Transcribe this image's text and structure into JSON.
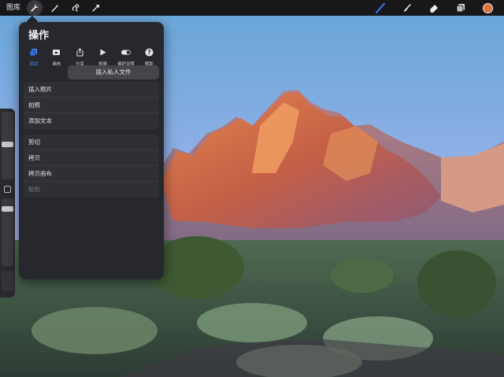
{
  "toolbar": {
    "gallery_label": "图库",
    "left_tools": [
      {
        "icon": "wrench-icon"
      },
      {
        "icon": "magic-wand-icon"
      },
      {
        "icon": "selection-icon"
      },
      {
        "icon": "transform-arrow-icon"
      }
    ],
    "right_tools": [
      {
        "icon": "brush-icon",
        "color": "#3d7dff"
      },
      {
        "icon": "smudge-icon",
        "color": "#ededed"
      },
      {
        "icon": "eraser-icon",
        "color": "#ededed"
      },
      {
        "icon": "layers-icon",
        "color": "#ededed"
      }
    ],
    "current_color": "#e0713b"
  },
  "actions_panel": {
    "title": "操作",
    "tabs": [
      {
        "label": "添加",
        "icon": "add-file-icon",
        "active": true
      },
      {
        "label": "画布",
        "icon": "canvas-icon",
        "active": false
      },
      {
        "label": "分享",
        "icon": "share-icon",
        "active": false
      },
      {
        "label": "视频",
        "icon": "video-play-icon",
        "active": false
      },
      {
        "label": "偏好设置",
        "icon": "toggle-icon",
        "active": false
      },
      {
        "label": "帮助",
        "icon": "help-icon",
        "active": false
      }
    ],
    "insert_private_file": "插入私人文件",
    "group1": [
      "插入照片",
      "拍照",
      "添加文本"
    ],
    "group2": [
      {
        "label": "剪切",
        "disabled": false
      },
      {
        "label": "拷贝",
        "disabled": false
      },
      {
        "label": "拷贝画布",
        "disabled": false
      },
      {
        "label": "粘贴",
        "disabled": true
      }
    ]
  }
}
